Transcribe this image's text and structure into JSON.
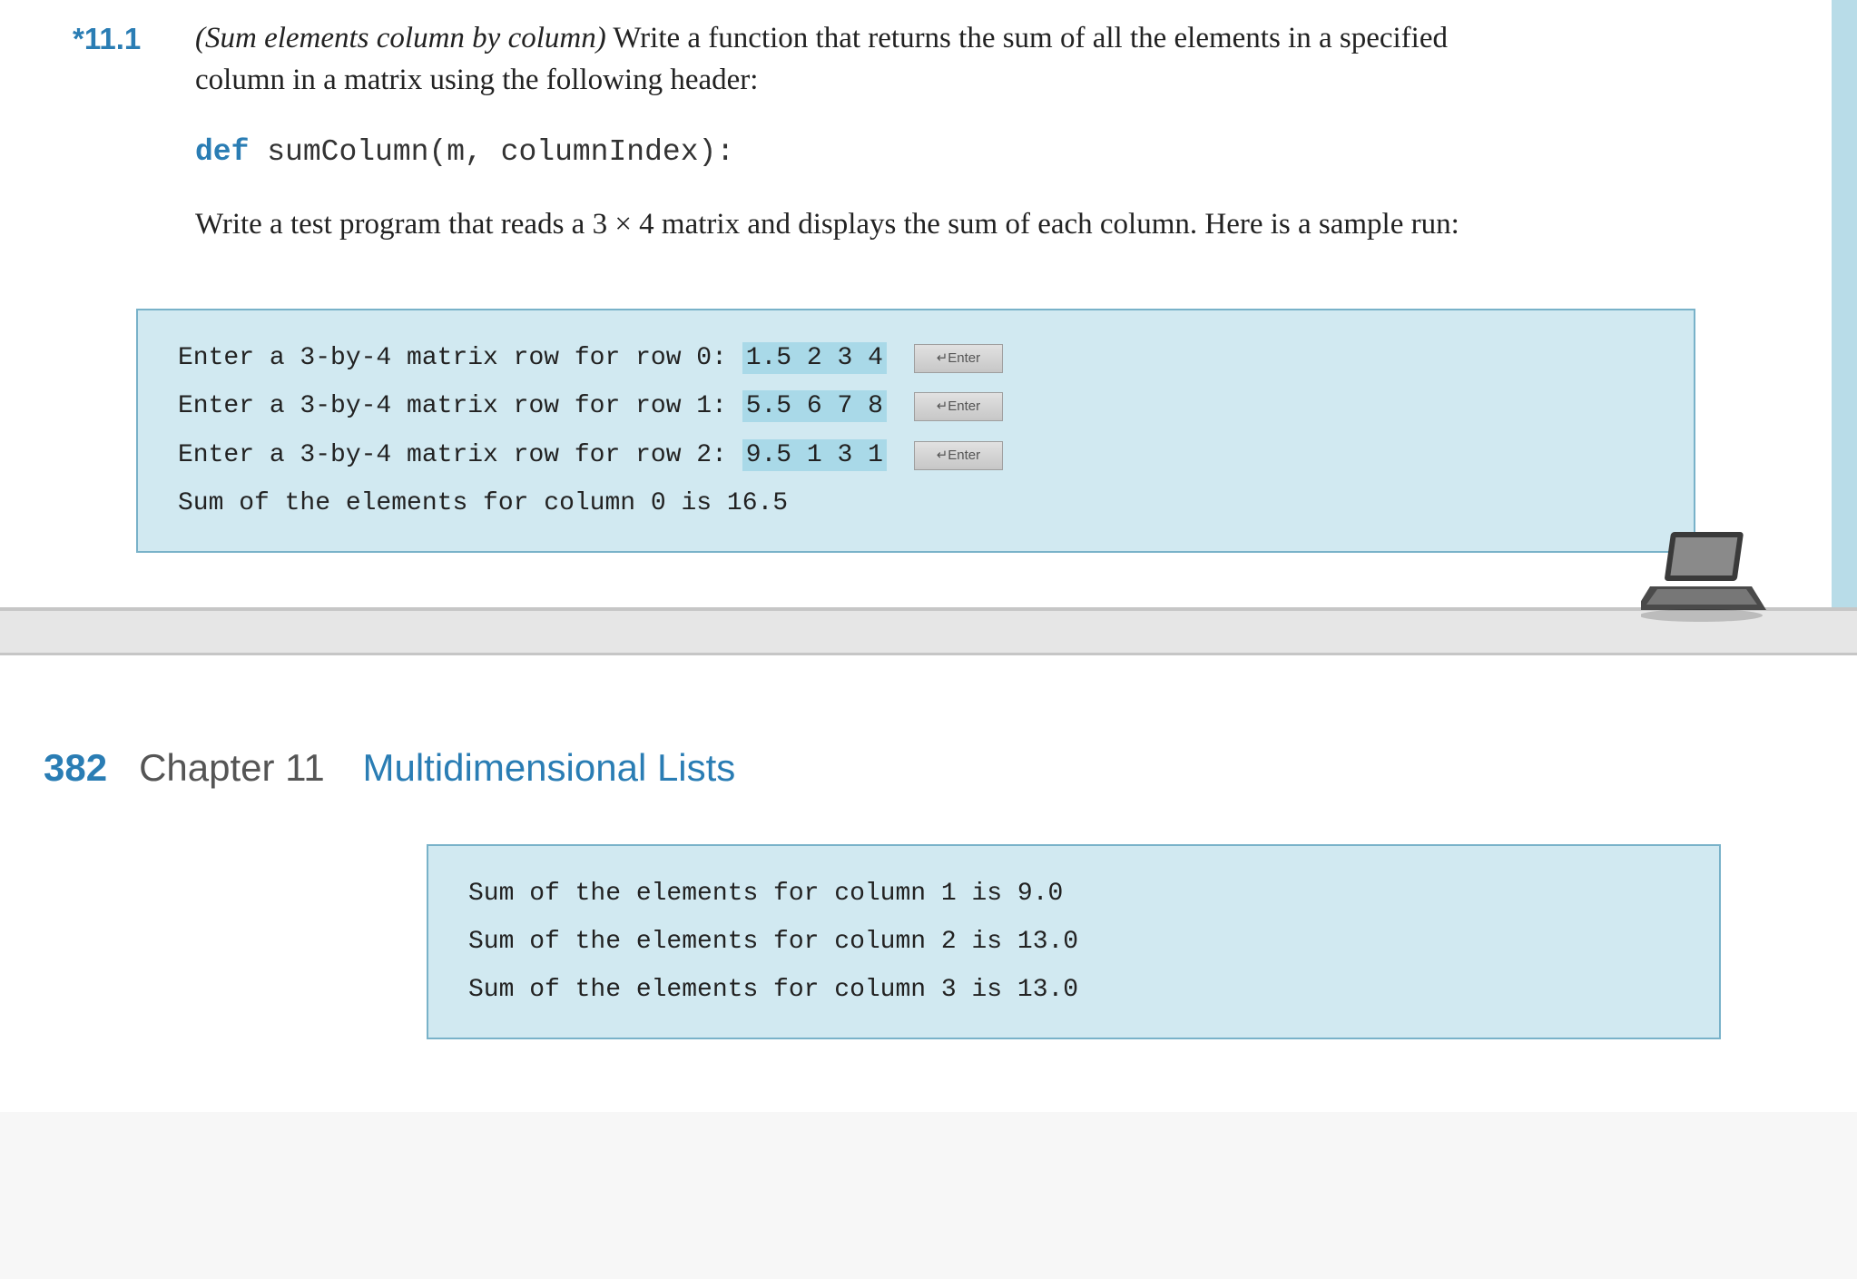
{
  "problem": {
    "number": "*11.1",
    "title": "(Sum elements column by column)",
    "desc1": " Write a function that returns the sum of all the elements in a specified column in a matrix using the following header:",
    "signature_kw": "def",
    "signature_rest": " sumColumn(m, columnIndex):",
    "desc2": "Write a test program that reads a 3 × 4 matrix and displays the sum of each column. Here is a sample run:"
  },
  "sample1": {
    "lines": [
      {
        "prompt": "Enter a 3-by-4 matrix row for row 0: ",
        "input": "1.5 2 3 4",
        "enter": "↵Enter"
      },
      {
        "prompt": "Enter a 3-by-4 matrix row for row 1: ",
        "input": "5.5 6 7 8",
        "enter": "↵Enter"
      },
      {
        "prompt": "Enter a 3-by-4 matrix row for row 2: ",
        "input": "9.5 1 3 1",
        "enter": "↵Enter"
      }
    ],
    "output": "Sum of the elements for column 0 is 16.5"
  },
  "chapter": {
    "page_num": "382",
    "label": "Chapter 11",
    "title": "Multidimensional Lists"
  },
  "sample2": {
    "lines": [
      "Sum of the elements for column 1 is 9.0",
      "Sum of the elements for column 2 is 13.0",
      "Sum of the elements for column 3 is 13.0"
    ]
  }
}
